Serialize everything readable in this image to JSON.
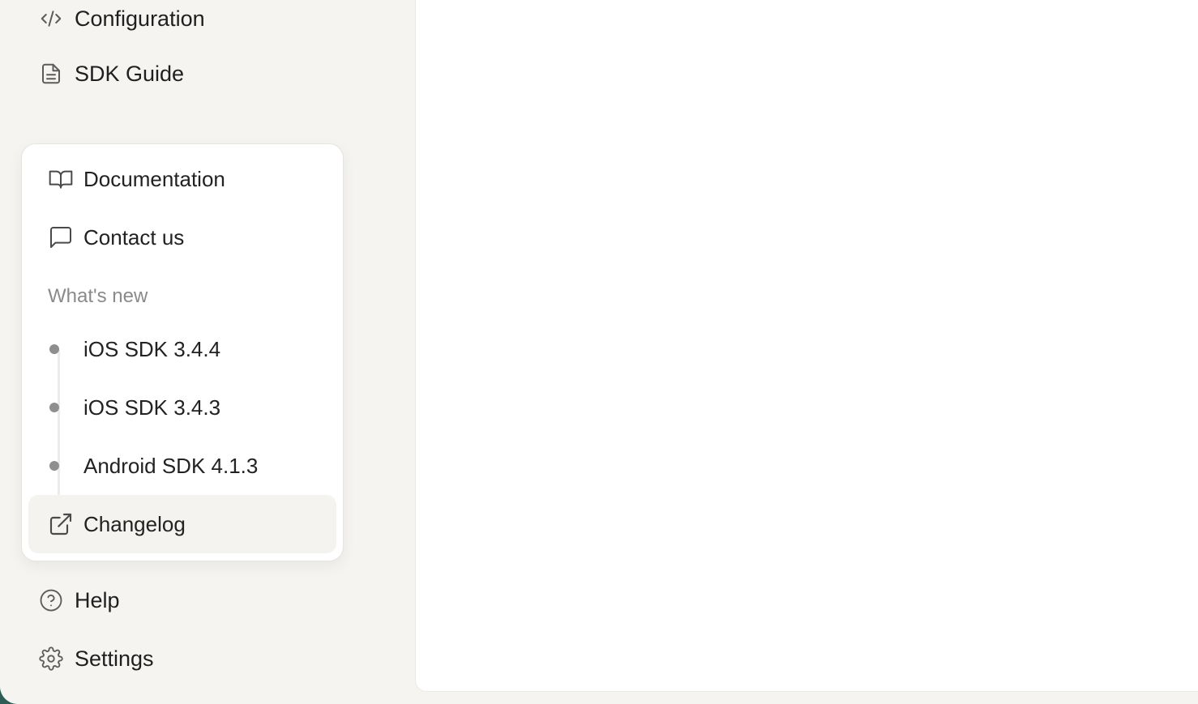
{
  "sidebar": {
    "top_items": [
      {
        "label": "Configuration",
        "icon": "code-icon"
      },
      {
        "label": "SDK Guide",
        "icon": "document-icon"
      }
    ],
    "bottom_items": [
      {
        "label": "Help",
        "icon": "help-circle-icon"
      },
      {
        "label": "Settings",
        "icon": "gear-icon"
      }
    ]
  },
  "popup": {
    "links": [
      {
        "label": "Documentation",
        "icon": "book-open-icon"
      },
      {
        "label": "Contact us",
        "icon": "message-square-icon"
      }
    ],
    "section_title": "What's new",
    "releases": [
      {
        "label": "iOS SDK 3.4.4"
      },
      {
        "label": "iOS SDK 3.4.3"
      },
      {
        "label": "Android SDK 4.1.3"
      }
    ],
    "changelog": {
      "label": "Changelog",
      "icon": "external-link-icon"
    }
  },
  "colors": {
    "sidebar_bg": "#f5f4f1",
    "panel_bg": "#ffffff",
    "desktop_bg": "#2f5d56",
    "muted_text": "#8a8a8a"
  }
}
